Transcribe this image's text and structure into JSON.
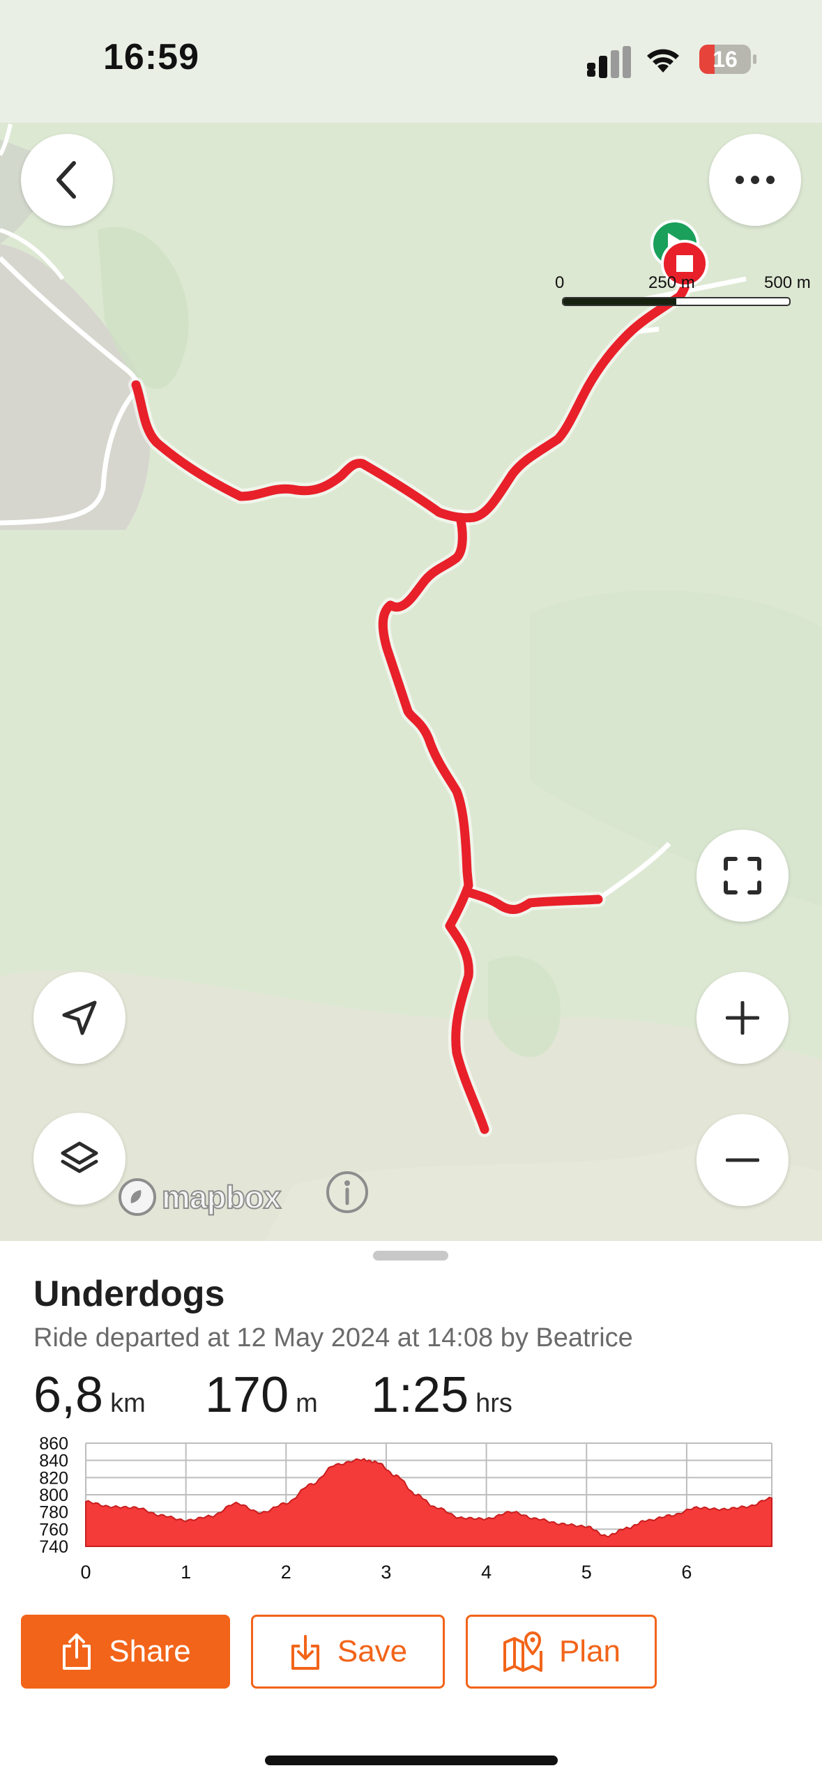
{
  "status_bar": {
    "time": "16:59",
    "battery": "16"
  },
  "map": {
    "scale_labels": [
      "0",
      "250 m",
      "500 m"
    ],
    "attribution": "mapbox",
    "icons": {
      "back": "chevron-left-icon",
      "more": "more-horizontal-icon",
      "fullscreen": "fullscreen-icon",
      "zoom_in": "plus-icon",
      "zoom_out": "minus-icon",
      "locate": "navigation-arrow-icon",
      "layers": "layers-icon",
      "info": "info-icon"
    },
    "route_color": "#e8202a",
    "start_marker_color": "#1aa05a",
    "end_marker_color": "#e8202a"
  },
  "ride": {
    "title": "Underdogs",
    "subtitle": "Ride departed at 12 May 2024 at 14:08 by Beatrice",
    "distance_value": "6,8",
    "distance_unit": "km",
    "elevation_value": "170",
    "elevation_unit": "m",
    "duration_value": "1:25",
    "duration_unit": "hrs"
  },
  "chart_data": {
    "type": "area",
    "xlabel": "",
    "ylabel": "",
    "xlim": [
      0,
      6.85
    ],
    "ylim": [
      740,
      860
    ],
    "x_ticks": [
      0,
      1,
      2,
      3,
      4,
      5,
      6
    ],
    "y_ticks": [
      740,
      760,
      780,
      800,
      820,
      840,
      860
    ],
    "color": "#f53a3a",
    "grid": true,
    "x": [
      0,
      0.25,
      0.5,
      0.75,
      1.0,
      1.25,
      1.5,
      1.75,
      2.0,
      2.25,
      2.5,
      2.75,
      2.9,
      3.1,
      3.3,
      3.5,
      3.75,
      4.0,
      4.25,
      4.5,
      4.75,
      5.0,
      5.2,
      5.4,
      5.6,
      5.85,
      6.1,
      6.35,
      6.6,
      6.85
    ],
    "values": [
      792,
      786,
      785,
      776,
      770,
      775,
      790,
      779,
      790,
      812,
      835,
      841,
      838,
      822,
      800,
      785,
      773,
      772,
      780,
      772,
      766,
      763,
      752,
      761,
      770,
      776,
      785,
      783,
      786,
      796
    ]
  },
  "actions": {
    "share": "Share",
    "save": "Save",
    "plan": "Plan"
  }
}
